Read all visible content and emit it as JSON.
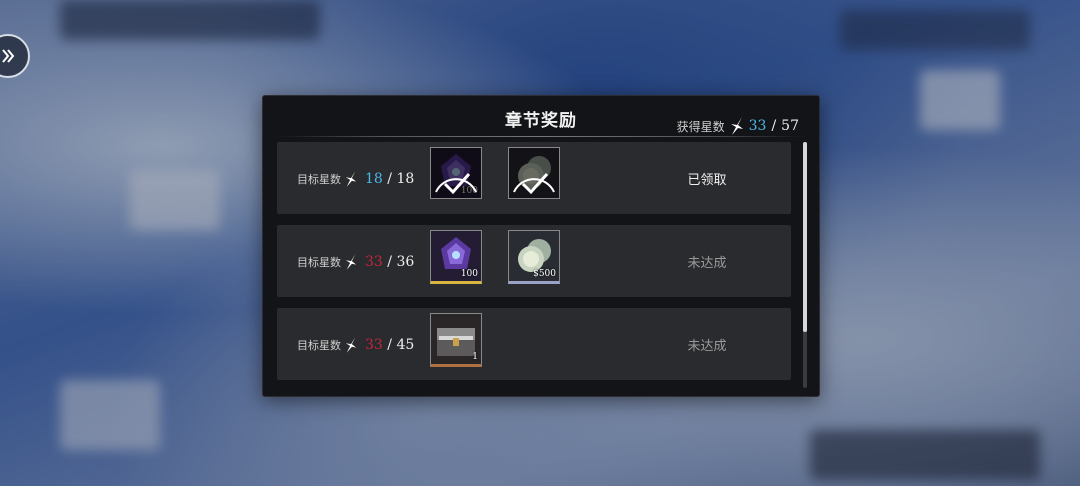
{
  "panel": {
    "title": "章节奖励",
    "total_label": "获得星数",
    "total_current": "33",
    "total_sep": "/",
    "total_max": "57"
  },
  "rows": [
    {
      "label": "目标星数",
      "got": "18",
      "sep": "/",
      "need": "18",
      "status": "已领取",
      "items": [
        {
          "icon": "crystal-icon",
          "count": "100",
          "claimed": true
        },
        {
          "icon": "coin-icon",
          "count": "",
          "claimed": true
        }
      ]
    },
    {
      "label": "目标星数",
      "got": "33",
      "sep": "/",
      "need": "36",
      "status": "未达成",
      "items": [
        {
          "icon": "crystal-icon",
          "count": "100",
          "claimed": false
        },
        {
          "icon": "coin-icon",
          "count": "$500",
          "claimed": false
        }
      ]
    },
    {
      "label": "目标星数",
      "got": "33",
      "sep": "/",
      "need": "45",
      "status": "未达成",
      "items": [
        {
          "icon": "chest-icon",
          "count": "1",
          "claimed": false
        }
      ]
    }
  ],
  "colors": {
    "star_done": "#4ab8e8",
    "star_short": "#c0283a"
  }
}
